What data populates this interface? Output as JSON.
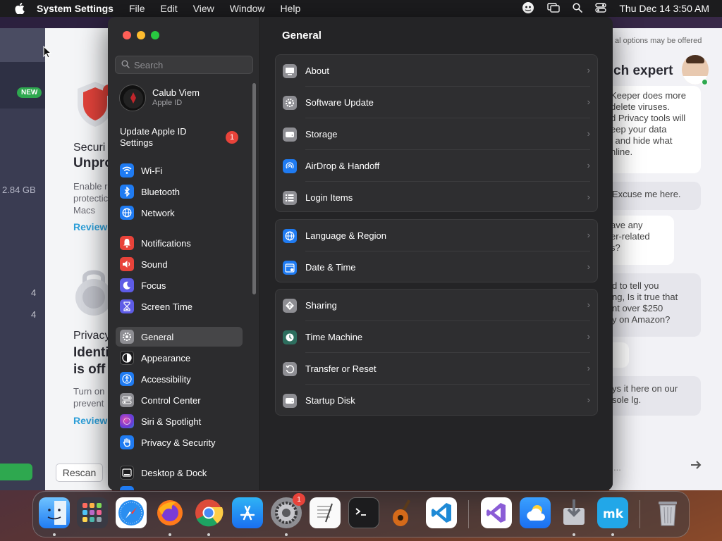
{
  "menubar": {
    "app": "System Settings",
    "items": [
      "File",
      "Edit",
      "View",
      "Window",
      "Help"
    ],
    "clock": "Thu Dec 14  3:50 AM"
  },
  "bg_left": {
    "badge_new": "NEW",
    "size": "2.84 GB",
    "num1": "4",
    "num2": "4",
    "securi": "Securi",
    "unpro": "Unpro",
    "enable1": "Enable r",
    "enable2": "protectic",
    "enable3": "Macs",
    "review1": "Review",
    "privacy": "Privacy",
    "identi": "Identi",
    "isoff": "is off",
    "turnon1": "Turn on",
    "turnon2": "prevent",
    "review2": "Review",
    "rescan": "Rescan"
  },
  "bg_chat": {
    "header_small": "al options may be offered",
    "header_big": "ch expert",
    "b1": [
      "Keeper does more",
      "delete viruses.",
      "d Privacy tools will",
      "eep your data",
      "l and hide what",
      "nline."
    ],
    "b2": [
      "Excuse me here."
    ],
    "b3": [
      "ave any",
      "er-related",
      "s?"
    ],
    "b4": [
      "d to tell you",
      "ng, Is it true that",
      "nt over $250",
      "y on Amazon?"
    ],
    "b5": [
      "ys it here on our",
      "sole lg."
    ],
    "input_ph": "..."
  },
  "sidebar": {
    "search_placeholder": "Search",
    "account_name": "Calub Viem",
    "account_sub": "Apple ID",
    "update_line1": "Update Apple ID",
    "update_line2": "Settings",
    "update_badge": "1",
    "items": [
      {
        "label": "Wi-Fi",
        "color": "#1f7bf2"
      },
      {
        "label": "Bluetooth",
        "color": "#1f7bf2"
      },
      {
        "label": "Network",
        "color": "#1f7bf2"
      },
      {
        "label": "Notifications",
        "color": "#e8433a"
      },
      {
        "label": "Sound",
        "color": "#e8433a"
      },
      {
        "label": "Focus",
        "color": "#5e5ce6"
      },
      {
        "label": "Screen Time",
        "color": "#5e5ce6"
      },
      {
        "label": "General",
        "color": "#8e8e93"
      },
      {
        "label": "Appearance",
        "color": "#1c1c1e"
      },
      {
        "label": "Accessibility",
        "color": "#1f7bf2"
      },
      {
        "label": "Control Center",
        "color": "#8e8e93"
      },
      {
        "label": "Siri & Spotlight",
        "color": "#b34fd6"
      },
      {
        "label": "Privacy & Security",
        "color": "#1f7bf2"
      },
      {
        "label": "Desktop & Dock",
        "color": "#1c1c1e"
      }
    ]
  },
  "content": {
    "title": "General",
    "groups": [
      [
        "About",
        "Software Update",
        "Storage",
        "AirDrop & Handoff",
        "Login Items"
      ],
      [
        "Language & Region",
        "Date & Time"
      ],
      [
        "Sharing",
        "Time Machine",
        "Transfer or Reset",
        "Startup Disk"
      ]
    ]
  },
  "dock": {
    "badge_settings": "1"
  }
}
